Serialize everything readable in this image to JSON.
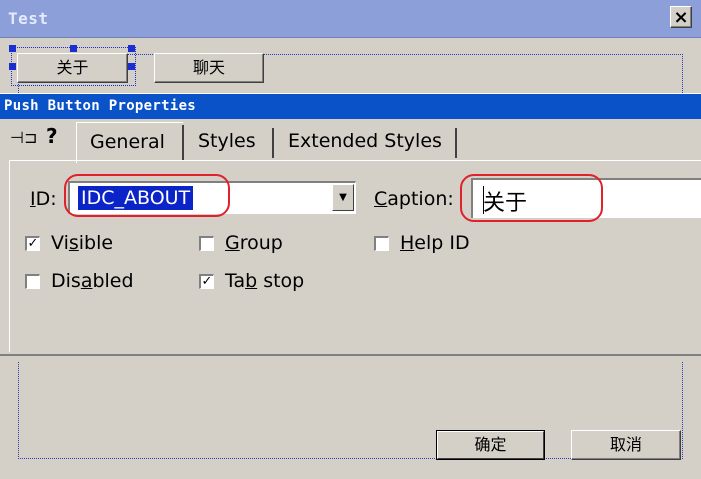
{
  "dialog": {
    "title": "Test",
    "close_glyph": "×",
    "buttons": {
      "about": "关于",
      "chat": "聊天",
      "ok": "确定",
      "cancel": "取消"
    }
  },
  "properties": {
    "title": "Push Button Properties",
    "pin_glyph": "⊣⊐",
    "help_glyph": "?",
    "tabs": [
      "General",
      "Styles",
      "Extended Styles"
    ],
    "id_label": {
      "pre": "",
      "u": "I",
      "post": "D:"
    },
    "id_value": "IDC_ABOUT",
    "caption_label": {
      "pre": "",
      "u": "C",
      "post": "aption:"
    },
    "caption_value": "关于",
    "checkboxes": {
      "visible": {
        "pre": "Vi",
        "u": "s",
        "post": "ible",
        "checked": true
      },
      "group": {
        "pre": "",
        "u": "G",
        "post": "roup",
        "checked": false
      },
      "helpid": {
        "pre": "",
        "u": "H",
        "post": "elp ID",
        "checked": false
      },
      "disabled": {
        "pre": "Dis",
        "u": "a",
        "post": "bled",
        "checked": false
      },
      "tabstop": {
        "pre": "Ta",
        "u": "b",
        "post": " stop",
        "checked": true
      }
    },
    "check_glyph": "✓",
    "dropdown_glyph": "▼"
  },
  "colors": {
    "highlight_ring": "#e0202a",
    "active_title": "#0a52c8",
    "inactive_title": "#8c9fd9"
  }
}
